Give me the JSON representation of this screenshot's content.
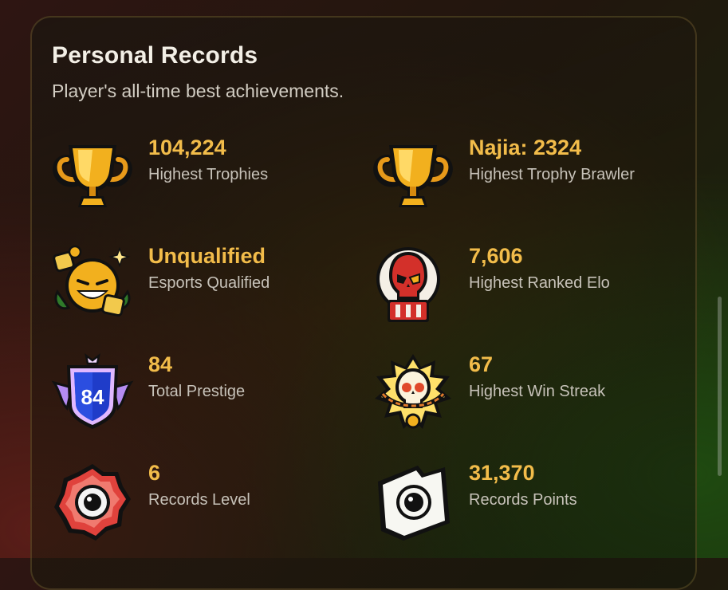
{
  "header": {
    "title": "Personal Records",
    "subtitle": "Player's all-time best achievements."
  },
  "records": [
    {
      "value": "104,224",
      "label": "Highest Trophies",
      "icon": "trophy-icon"
    },
    {
      "value": "Najia: 2324",
      "label": "Highest Trophy Brawler",
      "icon": "trophy-icon"
    },
    {
      "value": "Unqualified",
      "label": "Esports Qualified",
      "icon": "esports-badge-icon"
    },
    {
      "value": "7,606",
      "label": "Highest Ranked Elo",
      "icon": "ranked-skull-icon"
    },
    {
      "value": "84",
      "label": "Total Prestige",
      "icon": "prestige-shield-icon"
    },
    {
      "value": "67",
      "label": "Highest Win Streak",
      "icon": "win-streak-skull-icon"
    },
    {
      "value": "6",
      "label": "Records Level",
      "icon": "records-level-icon"
    },
    {
      "value": "31,370",
      "label": "Records Points",
      "icon": "records-points-icon"
    }
  ],
  "prestige_badge": "84",
  "colors": {
    "accent": "#f2bc4a",
    "title": "#f3efe6",
    "label": "#c7c2b9"
  }
}
